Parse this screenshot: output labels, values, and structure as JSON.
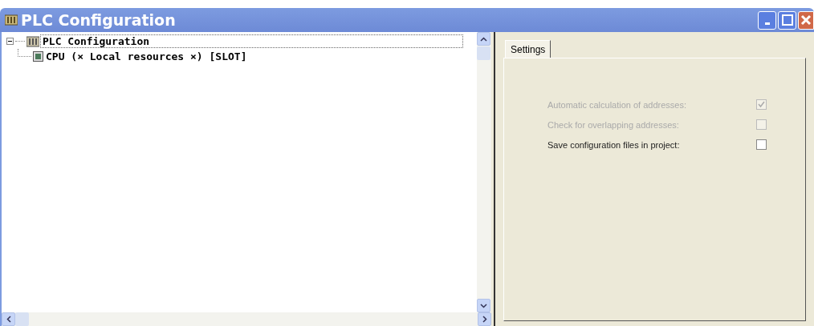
{
  "window": {
    "title": "PLC Configuration"
  },
  "tree": [
    {
      "label": "PLC Configuration",
      "expanded": true,
      "selected": true,
      "children": [
        {
          "label": "CPU (× Local resources ×) [SLOT]"
        }
      ]
    }
  ],
  "tabs": [
    {
      "label": "Settings",
      "selected": true
    }
  ],
  "options": [
    {
      "label": "Automatic calculation of addresses:",
      "checked": true,
      "disabled": true
    },
    {
      "label": "Check for overlapping addresses:",
      "checked": false,
      "disabled": true
    },
    {
      "label": "Save configuration files in project:",
      "checked": false,
      "disabled": false
    }
  ]
}
